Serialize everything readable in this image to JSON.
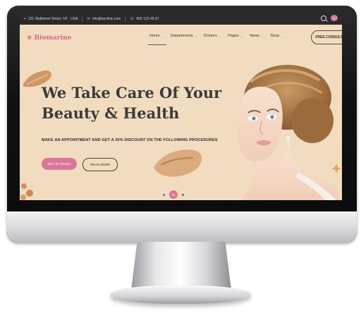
{
  "topbar": {
    "address": "121 Wallstreet Street, NY , USA",
    "email": "info@beclinic.com",
    "phone": "800 123 45 67",
    "cart_count": "0"
  },
  "header": {
    "logo_text": "Biomarine",
    "nav": [
      {
        "label": "Home",
        "active": true
      },
      {
        "label": "Departments"
      },
      {
        "label": "Doctors"
      },
      {
        "label": "Pages"
      },
      {
        "label": "News"
      },
      {
        "label": "Shop"
      }
    ],
    "cta_label": "FREE CONSULTATION"
  },
  "hero": {
    "title_line1": "We Take Care Of Your",
    "title_line2": "Beauty & Health",
    "promo": "MAKE AN APPOINTMENT AND GET A 20% DISCOUNT ON THE FOLLOWING PROCEDURES",
    "btn_primary": "GET IN TOUCH",
    "btn_secondary": "READ MORE",
    "slide_active": "02"
  },
  "colors": {
    "accent": "#d9779a",
    "hero_bg": "#f2dcbf",
    "topbar_bg": "#2a2a2e"
  }
}
